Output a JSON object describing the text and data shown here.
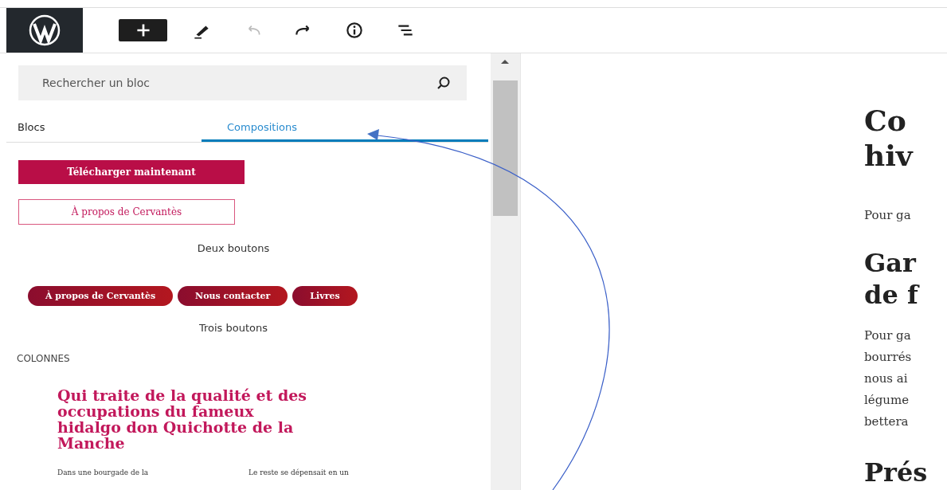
{
  "toolbar": [
    {
      "kind": "add",
      "disabled": false
    },
    {
      "kind": "edit",
      "disabled": false
    },
    {
      "kind": "undo",
      "disabled": true
    },
    {
      "kind": "redo",
      "disabled": false
    },
    {
      "kind": "info",
      "disabled": false
    },
    {
      "kind": "outline",
      "disabled": false
    }
  ],
  "inserter": {
    "search": {
      "placeholder": "Rechercher un bloc"
    },
    "tabs": [
      {
        "label": "Blocs",
        "selected": false
      },
      {
        "label": "Compositions",
        "selected": true
      }
    ],
    "patterns": [
      {
        "caption": "Deux boutons",
        "buttons": [
          {
            "label": "Télécharger maintenant",
            "kind": "fill"
          },
          {
            "label": "À propos de Cervantès",
            "kind": "outline"
          }
        ]
      },
      {
        "caption": "Trois boutons",
        "buttons": [
          {
            "label": "À propos de Cervantès",
            "kind": "pill"
          },
          {
            "label": "Nous contacter",
            "kind": "pill"
          },
          {
            "label": "Livres",
            "kind": "pill"
          }
        ]
      }
    ],
    "category": "COLONNES",
    "column_pattern": {
      "heading": [
        "Qui traite de la qualité et des",
        "occupations du fameux",
        "hidalgo don Quichotte de la",
        "Manche"
      ],
      "columns": [
        "Dans une bourgade de la",
        "Le reste se dépensait en un"
      ]
    }
  },
  "editor": {
    "blocks": [
      {
        "kind": "h1",
        "lines": [
          "Co",
          "hiv"
        ]
      },
      {
        "kind": "p",
        "lines": [
          "Pour ga"
        ]
      },
      {
        "kind": "h2",
        "lines": [
          "Gar",
          "de f"
        ]
      },
      {
        "kind": "p",
        "lines": [
          "Pour ga",
          "bourrés",
          "nous ai",
          "légume",
          "bettera"
        ]
      },
      {
        "kind": "h2",
        "lines": [
          "Prés"
        ]
      }
    ]
  }
}
